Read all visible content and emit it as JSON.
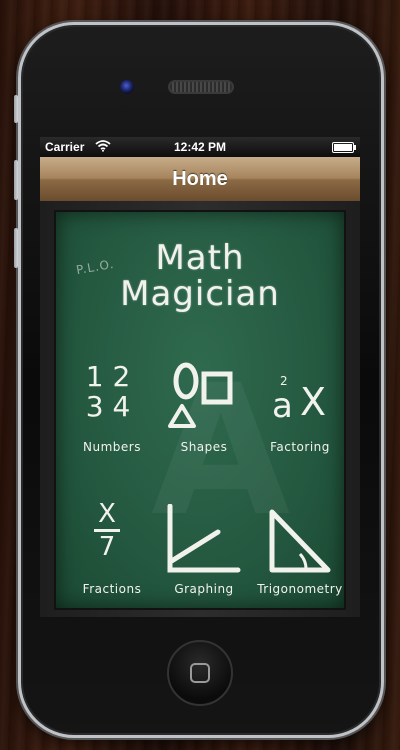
{
  "status_bar": {
    "carrier": "Carrier",
    "time": "12:42 PM"
  },
  "nav": {
    "title": "Home"
  },
  "board": {
    "initials": "P.L.O.",
    "title_line1": "Math",
    "title_line2": "Magician",
    "tiles": [
      {
        "label": "Numbers",
        "icon": "numbers-icon",
        "glyph_top": "1 2",
        "glyph_bottom": "3 4"
      },
      {
        "label": "Shapes",
        "icon": "shapes-icon"
      },
      {
        "label": "Factoring",
        "icon": "factoring-icon",
        "exponent": "2",
        "base": "a",
        "var": "X"
      },
      {
        "label": "Fractions",
        "icon": "fractions-icon",
        "numerator": "X",
        "denominator": "7"
      },
      {
        "label": "Graphing",
        "icon": "graphing-icon"
      },
      {
        "label": "Trigonometry",
        "icon": "trigonometry-icon"
      }
    ]
  },
  "colors": {
    "chalkboard": "#255a41",
    "navbar": "#a6845d",
    "chalk": "#f2f2ec"
  }
}
